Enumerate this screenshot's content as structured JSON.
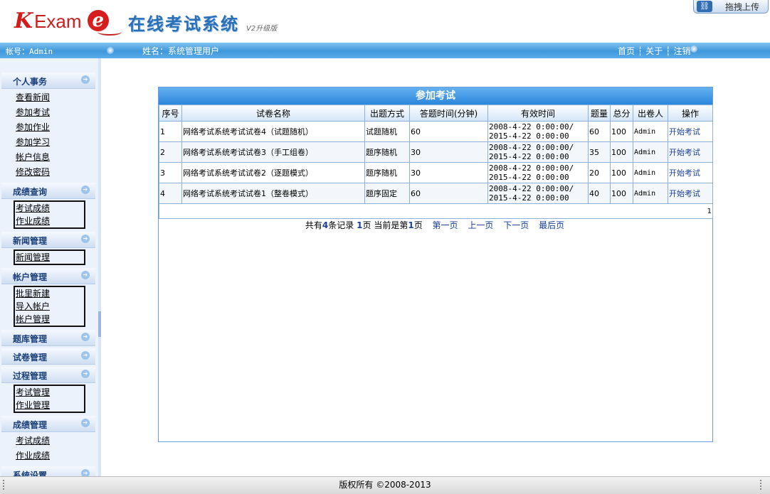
{
  "header": {
    "logo_k": "K",
    "logo_exam": "Exam",
    "logo_e": "e",
    "system_title": "在线考试系统",
    "version": "V2升级版",
    "upload_label": "拖拽上传"
  },
  "topbar": {
    "account": "帐号：Admin",
    "username": "姓名：系统管理用户",
    "nav": {
      "home": "首页",
      "about": "关于",
      "logout": "注销"
    }
  },
  "sidebar": {
    "personal": {
      "title": "个人事务",
      "items": [
        "查看新闻",
        "参加考试",
        "参加作业",
        "参加学习",
        "帐户信息",
        "修改密码"
      ]
    },
    "score_query": {
      "title": "成绩查询",
      "items": [
        "考试成绩",
        "作业成绩"
      ]
    },
    "news": {
      "title": "新闻管理",
      "items": [
        "新闻管理"
      ]
    },
    "account": {
      "title": "帐户管理",
      "items": [
        "批里新建",
        "导入帐户",
        "帐户管理"
      ]
    },
    "question_bank": {
      "title": "题库管理"
    },
    "paper": {
      "title": "试卷管理"
    },
    "process": {
      "title": "过程管理",
      "items": [
        "考试管理",
        "作业管理"
      ]
    },
    "score_manage": {
      "title": "成绩管理",
      "items": [
        "考试成绩",
        "作业成绩"
      ]
    },
    "system": {
      "title": "系统设置"
    }
  },
  "panel": {
    "title": "参加考试",
    "columns": [
      "序号",
      "试卷名称",
      "出题方式",
      "答题时间(分钟)",
      "有效时间",
      "题量",
      "总分",
      "出卷人",
      "操作"
    ],
    "rows": [
      {
        "no": "1",
        "name": "网络考试系统考试试卷4（试题随机）",
        "mode": "试题随机",
        "time": "60",
        "valid_from": "2008-4-22 0:00:00/",
        "valid_to": "2015-4-22 0:00:00",
        "count": "60",
        "score": "100",
        "author": "Admin",
        "action": "开始考试"
      },
      {
        "no": "2",
        "name": "网络考试系统考试试卷3（手工组卷）",
        "mode": "题序随机",
        "time": "30",
        "valid_from": "2008-4-22 0:00:00/",
        "valid_to": "2015-4-22 0:00:00",
        "count": "35",
        "score": "100",
        "author": "Admin",
        "action": "开始考试"
      },
      {
        "no": "3",
        "name": "网络考试系统考试试卷2（逐题模式）",
        "mode": "题序随机",
        "time": "30",
        "valid_from": "2008-4-22 0:00:00/",
        "valid_to": "2015-4-22 0:00:00",
        "count": "20",
        "score": "100",
        "author": "Admin",
        "action": "开始考试"
      },
      {
        "no": "4",
        "name": "网络考试系统考试试卷1（整卷模式）",
        "mode": "题序固定",
        "time": "60",
        "valid_from": "2008-4-22 0:00:00/",
        "valid_to": "2015-4-22 0:00:00",
        "count": "40",
        "score": "100",
        "author": "Admin",
        "action": "开始考试"
      }
    ],
    "footer_page": "1"
  },
  "pager": {
    "total_prefix": "共有",
    "total": "4",
    "total_suffix": "条记录",
    "pages": "1",
    "pages_suffix": "页",
    "current_prefix": "当前是第",
    "current": "1",
    "current_suffix": "页",
    "first": "第一页",
    "prev": "上一页",
    "next": "下一页",
    "last": "最后页"
  },
  "footer": {
    "copyright": "版权所有 ©2008-2013"
  }
}
